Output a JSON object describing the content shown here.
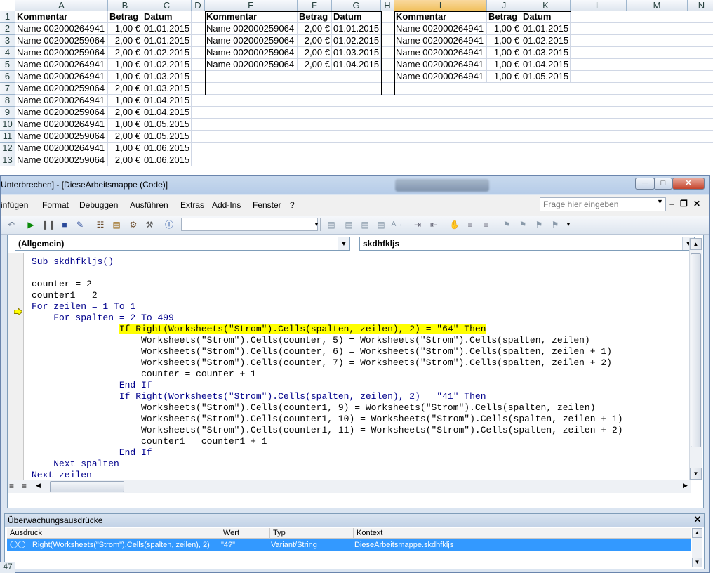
{
  "sheet": {
    "columns": [
      "A",
      "B",
      "C",
      "D",
      "E",
      "F",
      "G",
      "H",
      "I",
      "J",
      "K",
      "L",
      "M",
      "N"
    ],
    "rows": [
      "1",
      "2",
      "3",
      "4",
      "5",
      "6",
      "7",
      "8",
      "9",
      "10",
      "11",
      "12",
      "13"
    ],
    "table1": {
      "headers": [
        "Kommentar",
        "Betrag",
        "Datum"
      ],
      "rows": [
        [
          "Name 002000264941",
          "1,00 €",
          "01.01.2015"
        ],
        [
          "Name 002000259064",
          "2,00 €",
          "01.01.2015"
        ],
        [
          "Name 002000259064",
          "2,00 €",
          "01.02.2015"
        ],
        [
          "Name 002000264941",
          "1,00 €",
          "01.02.2015"
        ],
        [
          "Name 002000264941",
          "1,00 €",
          "01.03.2015"
        ],
        [
          "Name 002000259064",
          "2,00 €",
          "01.03.2015"
        ],
        [
          "Name 002000264941",
          "1,00 €",
          "01.04.2015"
        ],
        [
          "Name 002000259064",
          "2,00 €",
          "01.04.2015"
        ],
        [
          "Name 002000264941",
          "1,00 €",
          "01.05.2015"
        ],
        [
          "Name 002000259064",
          "2,00 €",
          "01.05.2015"
        ],
        [
          "Name 002000264941",
          "1,00 €",
          "01.06.2015"
        ],
        [
          "Name 002000259064",
          "2,00 €",
          "01.06.2015"
        ]
      ]
    },
    "table2": {
      "headers": [
        "Kommentar",
        "Betrag",
        "Datum"
      ],
      "rows": [
        [
          "Name 002000259064",
          "2,00 €",
          "01.01.2015"
        ],
        [
          "Name 002000259064",
          "2,00 €",
          "01.02.2015"
        ],
        [
          "Name 002000259064",
          "2,00 €",
          "01.03.2015"
        ],
        [
          "Name 002000259064",
          "2,00 €",
          "01.04.2015"
        ]
      ]
    },
    "table3": {
      "headers": [
        "Kommentar",
        "Betrag",
        "Datum"
      ],
      "rows": [
        [
          "Name 002000264941",
          "1,00 €",
          "01.01.2015"
        ],
        [
          "Name 002000264941",
          "1,00 €",
          "01.02.2015"
        ],
        [
          "Name 002000264941",
          "1,00 €",
          "01.03.2015"
        ],
        [
          "Name 002000264941",
          "1,00 €",
          "01.04.2015"
        ],
        [
          "Name 002000264941",
          "1,00 €",
          "01.05.2015"
        ]
      ]
    },
    "bottom_row": "47"
  },
  "vbe": {
    "title": "Unterbrechen] - [DieseArbeitsmappe (Code)]",
    "menu": [
      "infügen",
      "Format",
      "Debuggen",
      "Ausführen",
      "Extras",
      "Add-Ins",
      "Fenster",
      "?"
    ],
    "help_placeholder": "Frage hier eingeben",
    "object_combo": "(Allgemein)",
    "proc_combo": "skdhfkljs",
    "code_lines": [
      {
        "indent": 0,
        "text": "Sub skdhfkljs()",
        "hl": false
      },
      {
        "indent": 0,
        "text": "",
        "hl": false
      },
      {
        "indent": 0,
        "text": "counter = 2",
        "hl": false
      },
      {
        "indent": 0,
        "text": "counter1 = 2",
        "hl": false
      },
      {
        "indent": 0,
        "text": "For zeilen = 1 To 1",
        "hl": false
      },
      {
        "indent": 4,
        "text": "For spalten = 2 To 499",
        "hl": false
      },
      {
        "indent": 16,
        "text": "If Right(Worksheets(\"Strom\").Cells(spalten, zeilen), 2) = \"64\" Then",
        "hl": true
      },
      {
        "indent": 20,
        "text": "Worksheets(\"Strom\").Cells(counter, 5) = Worksheets(\"Strom\").Cells(spalten, zeilen)",
        "hl": false
      },
      {
        "indent": 20,
        "text": "Worksheets(\"Strom\").Cells(counter, 6) = Worksheets(\"Strom\").Cells(spalten, zeilen + 1)",
        "hl": false
      },
      {
        "indent": 20,
        "text": "Worksheets(\"Strom\").Cells(counter, 7) = Worksheets(\"Strom\").Cells(spalten, zeilen + 2)",
        "hl": false
      },
      {
        "indent": 20,
        "text": "counter = counter + 1",
        "hl": false
      },
      {
        "indent": 16,
        "text": "End If",
        "hl": false
      },
      {
        "indent": 16,
        "text": "If Right(Worksheets(\"Strom\").Cells(spalten, zeilen), 2) = \"41\" Then",
        "hl": false
      },
      {
        "indent": 20,
        "text": "Worksheets(\"Strom\").Cells(counter1, 9) = Worksheets(\"Strom\").Cells(spalten, zeilen)",
        "hl": false
      },
      {
        "indent": 20,
        "text": "Worksheets(\"Strom\").Cells(counter1, 10) = Worksheets(\"Strom\").Cells(spalten, zeilen + 1)",
        "hl": false
      },
      {
        "indent": 20,
        "text": "Worksheets(\"Strom\").Cells(counter1, 11) = Worksheets(\"Strom\").Cells(spalten, zeilen + 2)",
        "hl": false
      },
      {
        "indent": 20,
        "text": "counter1 = counter1 + 1",
        "hl": false
      },
      {
        "indent": 16,
        "text": "End If",
        "hl": false
      },
      {
        "indent": 4,
        "text": "Next spalten",
        "hl": false
      },
      {
        "indent": 0,
        "text": "Next zeilen",
        "hl": false
      },
      {
        "indent": 0,
        "text": "End Sub",
        "hl": false
      }
    ],
    "watch": {
      "title": "Überwachungsausdrücke",
      "headers": [
        "Ausdruck",
        "Wert",
        "Typ",
        "Kontext"
      ],
      "row": {
        "expression": "Right(Worksheets(\"Strom\").Cells(spalten, zeilen), 2)",
        "value": "\"4?\"",
        "type": "Variant/String",
        "context": "DieseArbeitsmappe.skdhfkljs"
      }
    }
  },
  "colors": {
    "highlight": "#ffff00",
    "keyword": "#00008b",
    "selection": "#3399ff"
  }
}
